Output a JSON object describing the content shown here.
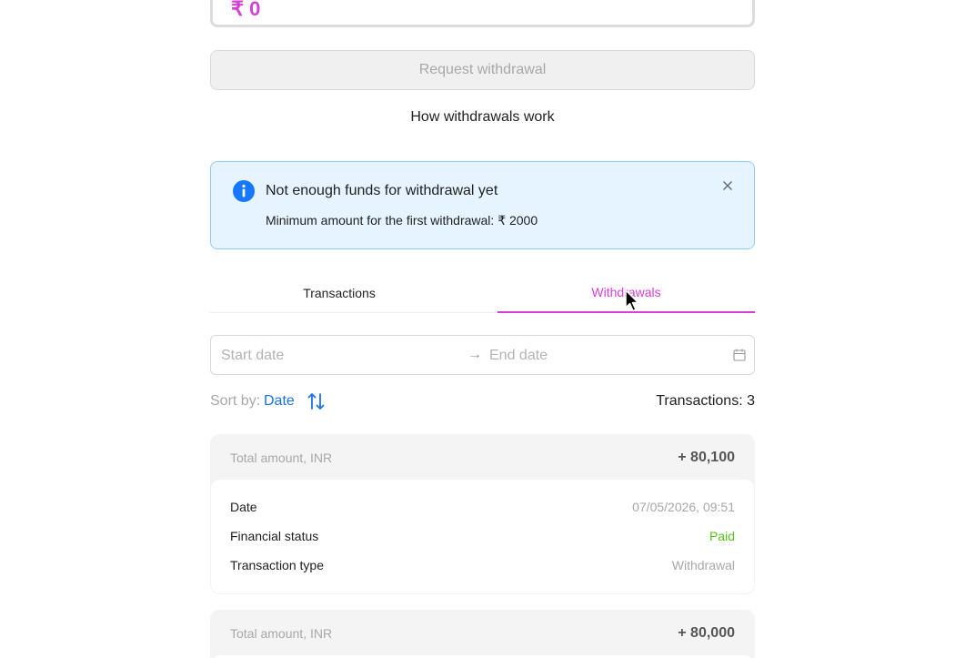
{
  "amount_input": {
    "value": "₹ 0"
  },
  "request_button": {
    "label": "Request withdrawal"
  },
  "how_link": {
    "label": "How withdrawals work"
  },
  "alert": {
    "title": "Not enough funds for withdrawal yet",
    "description": "Minimum amount for the first withdrawal: ₹ 2000",
    "icon": "info-icon",
    "close_icon": "close-icon"
  },
  "tabs": [
    {
      "label": "Transactions",
      "active": false
    },
    {
      "label": "Withdrawals",
      "active": true
    }
  ],
  "date_range": {
    "start_placeholder": "Start date",
    "separator": "→",
    "end_placeholder": "End date",
    "icon": "calendar-icon"
  },
  "sort": {
    "label": "Sort by:",
    "value": "Date",
    "icon": "sort-icon"
  },
  "transactions_count": "Transactions: 3",
  "cards": [
    {
      "total_label": "Total amount, INR",
      "total_value": "+ 80,100",
      "rows": [
        {
          "key": "Date",
          "value": "07/05/2026, 09:51"
        },
        {
          "key": "Financial status",
          "value": "Paid"
        },
        {
          "key": "Transaction type",
          "value": "Withdrawal"
        }
      ]
    },
    {
      "total_label": "Total amount, INR",
      "total_value": "+ 80,000"
    }
  ],
  "colors": {
    "accent": "#d43fd4",
    "link": "#1a73e8",
    "paid": "#52c41a",
    "alert_bg": "#e6f4ff",
    "alert_border": "#91caff",
    "info_icon": "#1677ff"
  }
}
